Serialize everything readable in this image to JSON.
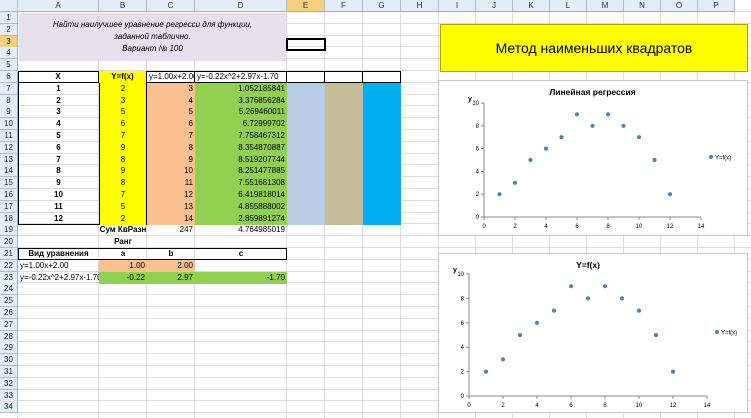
{
  "columns": [
    "A",
    "B",
    "C",
    "D",
    "E",
    "F",
    "G",
    "H",
    "I",
    "J",
    "K",
    "L",
    "M",
    "N",
    "O",
    "P"
  ],
  "rows": [
    "1",
    "2",
    "3",
    "4",
    "5",
    "6",
    "7",
    "8",
    "9",
    "10",
    "11",
    "12",
    "13",
    "14",
    "15",
    "16",
    "17",
    "18",
    "19",
    "20",
    "21",
    "22",
    "23",
    "24",
    "25",
    "26",
    "27",
    "28",
    "29",
    "30",
    "31",
    "32",
    "33",
    "34"
  ],
  "task_text": "Найти наилучшее уравнение регресси для функции, заданной таблично.",
  "variant": "Вариант № 100",
  "banner_title": "Метод наименьших квадратов",
  "table": {
    "headers": [
      "X",
      "Y=f(x)",
      "y=1.00x+2.00",
      "y=-0.22x^2+2.97x-1.70"
    ],
    "rows": [
      [
        "1",
        "2",
        "3",
        "1.052185841"
      ],
      [
        "2",
        "3",
        "4",
        "3.376856284"
      ],
      [
        "3",
        "5",
        "5",
        "5.269460011"
      ],
      [
        "4",
        "6",
        "6",
        "6.72999702"
      ],
      [
        "5",
        "7",
        "7",
        "7.758467312"
      ],
      [
        "6",
        "9",
        "8",
        "8.354870887"
      ],
      [
        "7",
        "8",
        "9",
        "8.519207744"
      ],
      [
        "8",
        "9",
        "10",
        "8.251477885"
      ],
      [
        "9",
        "8",
        "11",
        "7.551681308"
      ],
      [
        "10",
        "7",
        "12",
        "6.419818014"
      ],
      [
        "11",
        "5",
        "13",
        "4.855888002"
      ],
      [
        "12",
        "2",
        "14",
        "2.859891274"
      ]
    ]
  },
  "sum_label": "Сум КвРазн",
  "sum_c": "247",
  "sum_d": "4.764985019",
  "rank_label": "Ранг",
  "coef_headers": [
    "Вид уравнения",
    "a",
    "b",
    "c"
  ],
  "coef_rows": [
    [
      "y=1.00x+2.00",
      "1.00",
      "2.00",
      ""
    ],
    [
      "y=-0.22x^2+2.97x-1.70",
      "-0.22",
      "2.97",
      "-1.70"
    ]
  ],
  "colors": {
    "yellow": "#ffff00",
    "orange": "#fac090",
    "green": "#92d050",
    "blue_light": "#b8cce4",
    "khaki": "#c4bd97",
    "cyan": "#00b0f0",
    "banner": "#ffff00",
    "task_bg": "#e6e0ec"
  },
  "chart_data": [
    {
      "type": "scatter",
      "title": "Линейная регрессия",
      "ylabel": "y",
      "legend": "Y=f(x)",
      "legend_position": "right",
      "xlim": [
        0,
        14
      ],
      "ylim": [
        0,
        10
      ],
      "xticks": [
        "0",
        "2",
        "4",
        "6",
        "8",
        "10",
        "12",
        "14"
      ],
      "yticks": [
        "0",
        "2",
        "4",
        "6",
        "8",
        "10"
      ],
      "x": [
        1,
        2,
        3,
        4,
        5,
        6,
        7,
        8,
        9,
        10,
        11,
        12
      ],
      "y": [
        2,
        3,
        5,
        6,
        7,
        9,
        8,
        9,
        8,
        7,
        5,
        2
      ],
      "grid": false
    },
    {
      "type": "scatter",
      "title": "Y=f(x)",
      "ylabel": "y",
      "legend": "Y=f(x)",
      "legend_position": "right",
      "xlim": [
        0,
        14
      ],
      "ylim": [
        0,
        10
      ],
      "xticks": [
        "0",
        "2",
        "4",
        "6",
        "8",
        "10",
        "12",
        "14"
      ],
      "yticks": [
        "0",
        "2",
        "4",
        "6",
        "8",
        "10"
      ],
      "x": [
        1,
        2,
        3,
        4,
        5,
        6,
        7,
        8,
        9,
        10,
        11,
        12
      ],
      "y": [
        2,
        3,
        5,
        6,
        7,
        9,
        8,
        9,
        8,
        7,
        5,
        2
      ],
      "grid": false
    }
  ]
}
